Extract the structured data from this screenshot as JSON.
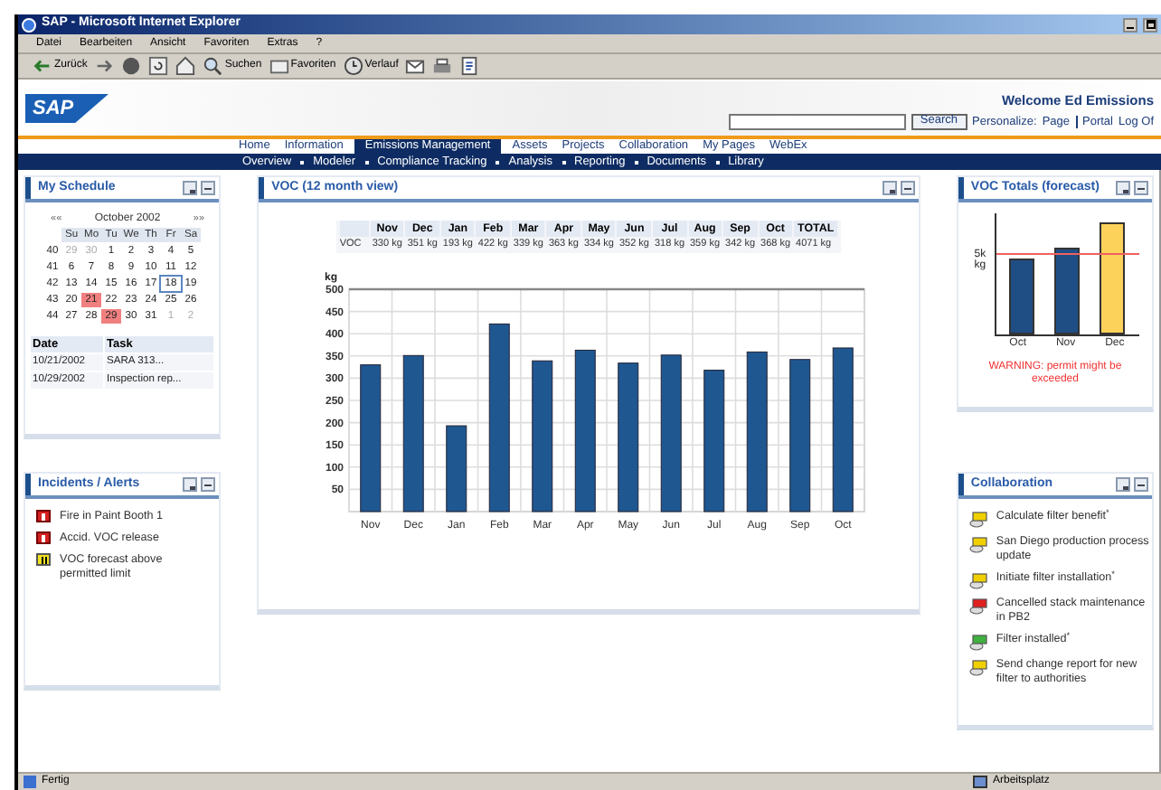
{
  "window": {
    "title": "SAP - Microsoft Internet Explorer"
  },
  "menu": [
    "Datei",
    "Bearbeiten",
    "Ansicht",
    "Favoriten",
    "Extras",
    "?"
  ],
  "toolbar": [
    {
      "kind": "back",
      "label": "Zurück"
    },
    {
      "kind": "forward"
    },
    {
      "kind": "stop"
    },
    {
      "kind": "refresh"
    },
    {
      "kind": "home"
    },
    {
      "kind": "search",
      "label": "Suchen"
    },
    {
      "kind": "favorites",
      "label": "Favoriten"
    },
    {
      "kind": "history",
      "label": "Verlauf"
    },
    {
      "kind": "mail"
    },
    {
      "kind": "print"
    },
    {
      "kind": "edit"
    }
  ],
  "portal": {
    "logo": "SAP",
    "welcome": "Welcome Ed Emissions",
    "search_button": "Search",
    "personalize": "Personalize:",
    "links": [
      "Page",
      "Portal",
      "Log Of"
    ]
  },
  "top_nav": [
    {
      "label": "Home",
      "selected": false
    },
    {
      "label": "Information",
      "selected": false
    },
    {
      "label": "Emissions Management",
      "selected": true
    },
    {
      "label": "Assets",
      "selected": false
    },
    {
      "label": "Projects",
      "selected": false
    },
    {
      "label": "Collaboration",
      "selected": false
    },
    {
      "label": "My Pages",
      "selected": false
    },
    {
      "label": "WebEx",
      "selected": false
    }
  ],
  "sub_nav": [
    "Overview",
    "Modeler",
    "Compliance Tracking",
    "Analysis",
    "Reporting",
    "Documents",
    "Library"
  ],
  "schedule": {
    "title": "My Schedule",
    "calendar": {
      "prev": "««",
      "month": "October 2002",
      "next": "»»",
      "weekdays": [
        "Su",
        "Mo",
        "Tu",
        "We",
        "Th",
        "Fr",
        "Sa"
      ],
      "weeks": [
        {
          "week": "40",
          "days": [
            {
              "d": "29",
              "kind": "other"
            },
            {
              "d": "30",
              "kind": "other"
            },
            {
              "d": "1",
              "kind": "normal"
            },
            {
              "d": "2",
              "kind": "normal"
            },
            {
              "d": "3",
              "kind": "normal"
            },
            {
              "d": "4",
              "kind": "normal"
            },
            {
              "d": "5",
              "kind": "normal"
            }
          ]
        },
        {
          "week": "41",
          "days": [
            {
              "d": "6",
              "kind": "normal"
            },
            {
              "d": "7",
              "kind": "normal"
            },
            {
              "d": "8",
              "kind": "normal"
            },
            {
              "d": "9",
              "kind": "normal"
            },
            {
              "d": "10",
              "kind": "normal"
            },
            {
              "d": "11",
              "kind": "normal"
            },
            {
              "d": "12",
              "kind": "normal"
            }
          ]
        },
        {
          "week": "42",
          "days": [
            {
              "d": "13",
              "kind": "normal"
            },
            {
              "d": "14",
              "kind": "normal"
            },
            {
              "d": "15",
              "kind": "normal"
            },
            {
              "d": "16",
              "kind": "normal"
            },
            {
              "d": "17",
              "kind": "normal"
            },
            {
              "d": "18",
              "kind": "today"
            },
            {
              "d": "19",
              "kind": "normal"
            }
          ]
        },
        {
          "week": "43",
          "days": [
            {
              "d": "20",
              "kind": "normal"
            },
            {
              "d": "21",
              "kind": "event"
            },
            {
              "d": "22",
              "kind": "normal"
            },
            {
              "d": "23",
              "kind": "normal"
            },
            {
              "d": "24",
              "kind": "normal"
            },
            {
              "d": "25",
              "kind": "normal"
            },
            {
              "d": "26",
              "kind": "normal"
            }
          ]
        },
        {
          "week": "44",
          "days": [
            {
              "d": "27",
              "kind": "normal"
            },
            {
              "d": "28",
              "kind": "normal"
            },
            {
              "d": "29",
              "kind": "event"
            },
            {
              "d": "30",
              "kind": "normal"
            },
            {
              "d": "31",
              "kind": "normal"
            },
            {
              "d": "1",
              "kind": "other"
            },
            {
              "d": "2",
              "kind": "other"
            }
          ]
        }
      ]
    },
    "table": {
      "columns": [
        "Date",
        "Task"
      ],
      "rows": [
        [
          "10/21/2002",
          "SARA 313..."
        ],
        [
          "10/29/2002",
          "Inspection rep..."
        ]
      ]
    }
  },
  "incidents": {
    "title": "Incidents / Alerts",
    "items": [
      {
        "kind": "fire",
        "text": "Fire in Paint Booth 1"
      },
      {
        "kind": "fire",
        "text": "Accid. VOC release"
      },
      {
        "kind": "warning",
        "text": "VOC forecast above permitted limit"
      }
    ]
  },
  "voc": {
    "title": "VOC (12 month view)",
    "table": {
      "columns": [
        "Nov",
        "Dec",
        "Jan",
        "Feb",
        "Mar",
        "Apr",
        "May",
        "Jun",
        "Jul",
        "Aug",
        "Sep",
        "Oct",
        "TOTAL"
      ],
      "row": {
        "label": "VOC",
        "cells": [
          "330 kg",
          "351 kg",
          "193 kg",
          "422 kg",
          "339 kg",
          "363 kg",
          "334 kg",
          "352 kg",
          "318 kg",
          "359 kg",
          "342 kg",
          "368 kg",
          "4071 kg"
        ]
      }
    },
    "chart_data": {
      "type": "bar",
      "ylabel": "kg",
      "categories": [
        "Nov",
        "Dec",
        "Jan",
        "Feb",
        "Mar",
        "Apr",
        "May",
        "Jun",
        "Jul",
        "Aug",
        "Sep",
        "Oct"
      ],
      "grid": true,
      "series": [
        {
          "color": "#1f5791",
          "values": [
            330,
            351,
            193,
            422,
            339,
            363,
            334,
            352,
            318,
            359,
            342,
            368
          ]
        }
      ],
      "ylim": [
        0,
        500
      ],
      "yticks": [
        50,
        100,
        150,
        200,
        250,
        300,
        350,
        400,
        450,
        500
      ]
    }
  },
  "forecast": {
    "title": "VOC Totals (forecast)",
    "limit_label": "5k kg",
    "bars": [
      {
        "label": "Oct",
        "color": "#1f4e85"
      },
      {
        "label": "Nov",
        "color": "#1f4e85"
      },
      {
        "label": "Dec",
        "color": "#fcd25a"
      }
    ],
    "warning": "WARNING: permit might be exceeded"
  },
  "collaboration": {
    "title": "Collaboration",
    "items": [
      {
        "kind": "note",
        "text": "Calculate filter benefit$^{*}$"
      },
      {
        "kind": "note",
        "text": "San Diego production process update"
      },
      {
        "kind": "note",
        "text": "Initiate filter installation$^{*}$"
      },
      {
        "kind": "cancelled",
        "text": "Cancelled stack maintenance in PB2"
      },
      {
        "kind": "done",
        "text": "Filter installed$^{*}$"
      },
      {
        "kind": "note",
        "text": "Send change report for new filter to authorities"
      }
    ]
  },
  "status_bar": {
    "left": "Fertig",
    "right": "Arbeitsplatz"
  }
}
